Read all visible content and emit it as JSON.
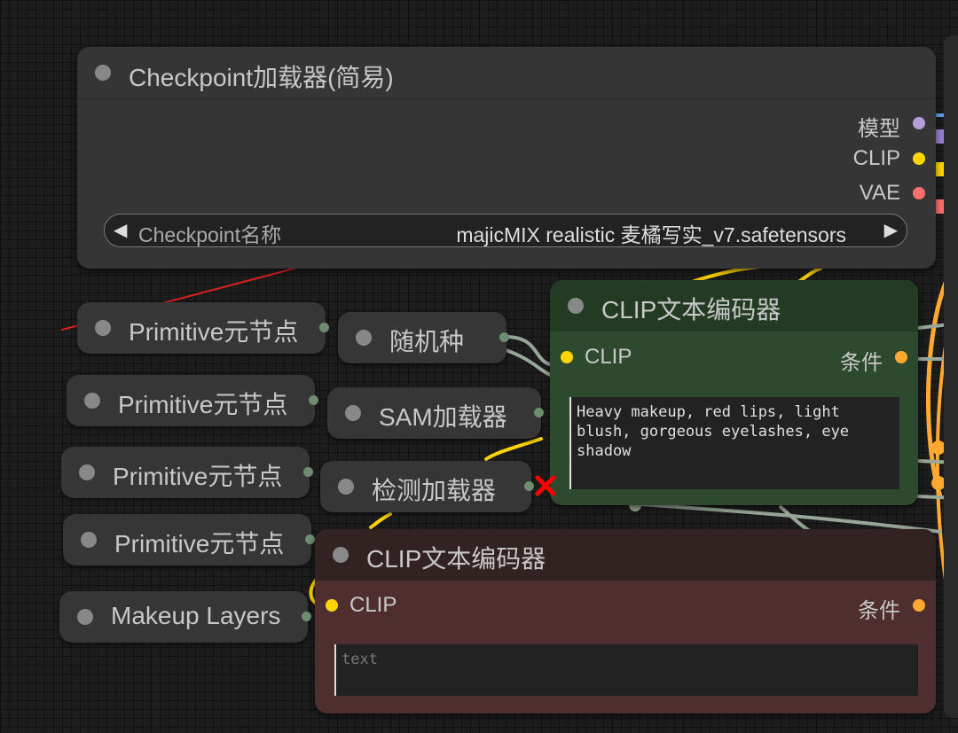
{
  "checkpoint_node": {
    "title": "Checkpoint加载器(简易)",
    "outputs": [
      {
        "label": "模型",
        "color": "#b39ddb"
      },
      {
        "label": "CLIP",
        "color": "#ffd500"
      },
      {
        "label": "VAE",
        "color": "#ff6e6e"
      }
    ],
    "widget": {
      "label": "Checkpoint名称",
      "value": "majicMIX realistic 麦橘写实_v7.safetensors",
      "left_arrow": "◀",
      "right_arrow": "▶"
    }
  },
  "primitive_nodes": [
    {
      "title": "Primitive元节点"
    },
    {
      "title": "Primitive元节点"
    },
    {
      "title": "Primitive元节点"
    },
    {
      "title": "Primitive元节点"
    },
    {
      "title": "Makeup Layers"
    }
  ],
  "loader_nodes": [
    {
      "title": "随机种"
    },
    {
      "title": "SAM加载器"
    },
    {
      "title": "检测加载器"
    }
  ],
  "clip_encoder_positive": {
    "title": "CLIP文本编码器",
    "input_label": "CLIP",
    "output_label": "条件",
    "text": "Heavy makeup, red lips, light blush, gorgeous eyelashes, eye shadow",
    "bg_color": "#2e4a2e"
  },
  "clip_encoder_negative": {
    "title": "CLIP文本编码器",
    "input_label": "CLIP",
    "output_label": "条件",
    "placeholder": "text",
    "bg_color": "#4e2e2e"
  },
  "colors": {
    "clip": "#ffd500",
    "conditioning": "#ffa931",
    "model": "#b39ddb",
    "vae": "#ff6e6e",
    "error": "#ff0000",
    "annotation_arrow": "#e02020"
  }
}
